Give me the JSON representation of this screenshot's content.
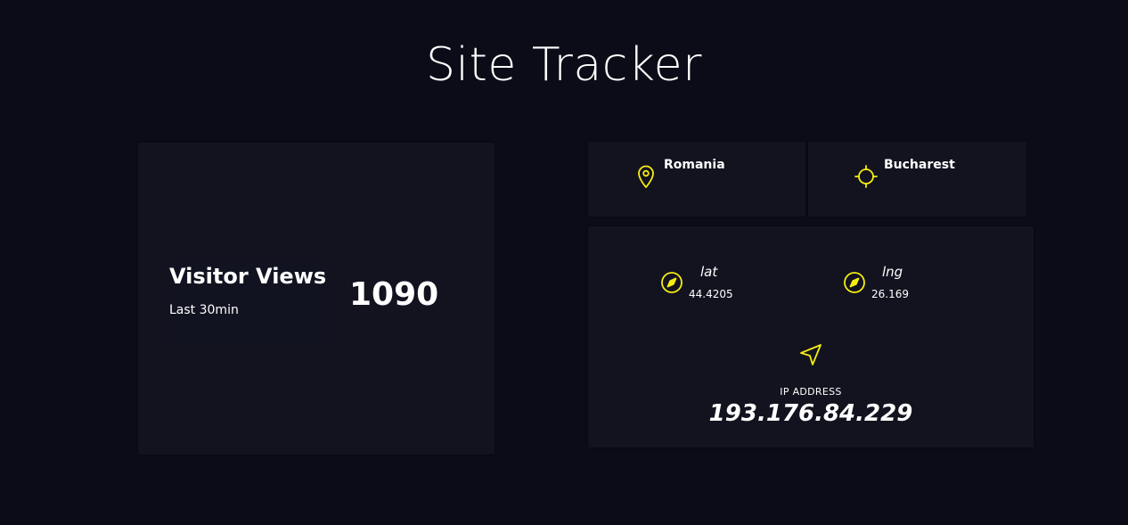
{
  "header": {
    "title": "Site Tracker"
  },
  "visitors": {
    "title": "Visitor Views",
    "subtitle": "Last 30min",
    "count": "1090"
  },
  "location": {
    "country": "Romania",
    "country_icon": "map-pin-icon",
    "city": "Bucharest",
    "city_icon": "crosshair-icon"
  },
  "coordinates": {
    "lat_label": "lat",
    "lat_value": "44.4205",
    "lat_icon": "compass-icon",
    "lng_label": "lng",
    "lng_value": "26.169",
    "lng_icon": "compass-icon"
  },
  "ip": {
    "label": "IP ADDRESS",
    "value": "193.176.84.229",
    "icon": "navigation-icon"
  },
  "colors": {
    "background": "#0b0c17",
    "card": "#12131f",
    "accent": "#f7ec13",
    "text": "#ffffff"
  }
}
